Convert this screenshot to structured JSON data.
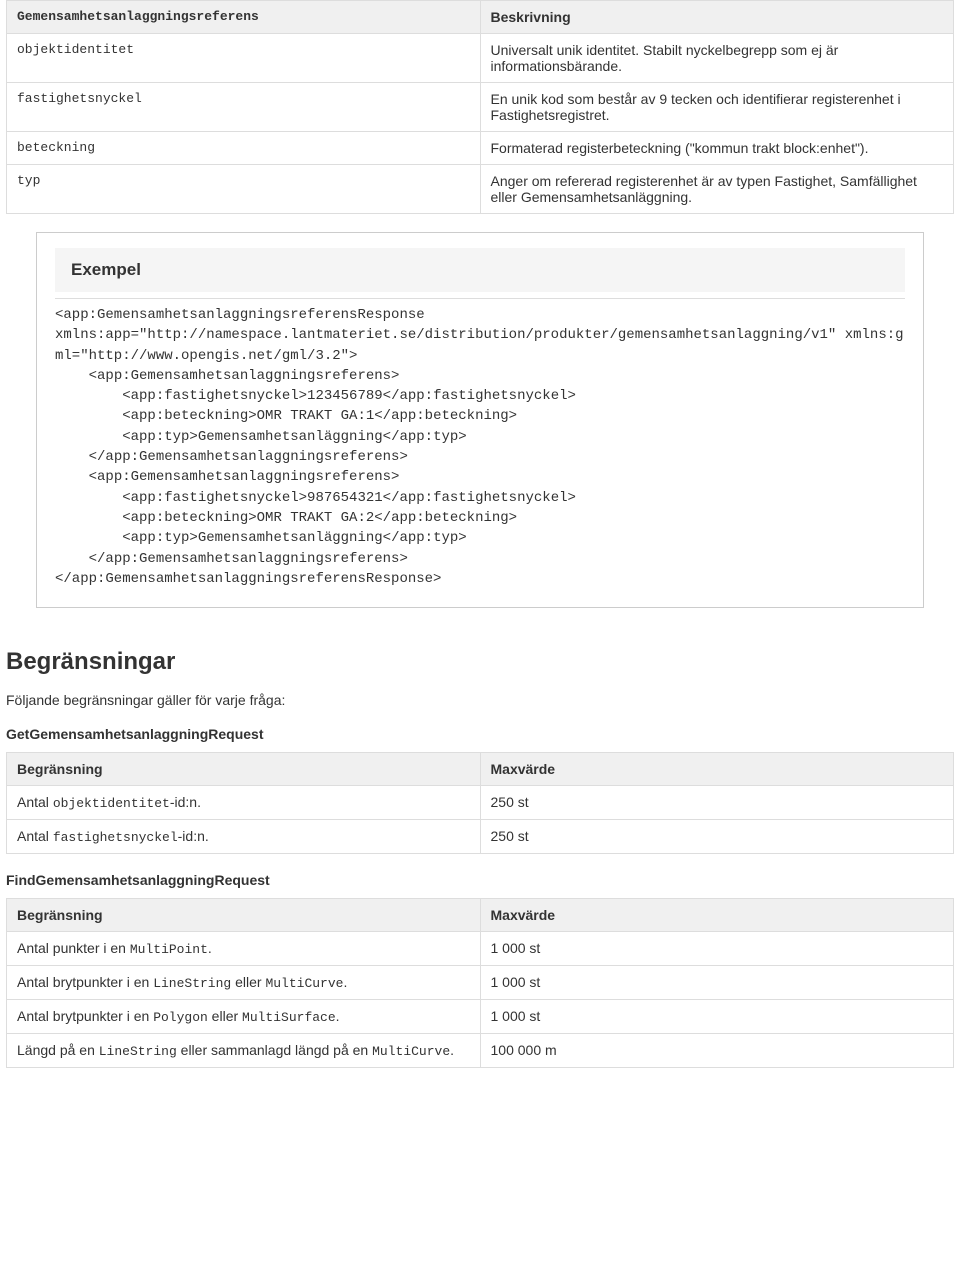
{
  "table1": {
    "headers": [
      "Gemensamhetsanlaggningsreferens",
      "Beskrivning"
    ],
    "rows": [
      {
        "name": "objektidentitet",
        "desc": "Universalt unik identitet. Stabilt nyckelbegrepp som ej är informationsbärande."
      },
      {
        "name": "fastighetsnyckel",
        "desc": "En unik kod som består av 9 tecken och identifierar registerenhet i Fastighetsregistret."
      },
      {
        "name": "beteckning",
        "desc": "Formaterad registerbeteckning (\"kommun trakt block:enhet\")."
      },
      {
        "name": "typ",
        "desc": "Anger om refererad registerenhet är av typen Fastighet, Samfällighet eller Gemensamhetsanläggning."
      }
    ]
  },
  "example": {
    "title": "Exempel",
    "code": "<app:GemensamhetsanlaggningsreferensResponse\nxmlns:app=\"http://namespace.lantmateriet.se/distribution/produkter/gemensamhetsanlaggning/v1\" xmlns:gml=\"http://www.opengis.net/gml/3.2\">\n    <app:Gemensamhetsanlaggningsreferens>\n        <app:fastighetsnyckel>123456789</app:fastighetsnyckel>\n        <app:beteckning>OMR TRAKT GA:1</app:beteckning>\n        <app:typ>Gemensamhetsanläggning</app:typ>\n    </app:Gemensamhetsanlaggningsreferens>\n    <app:Gemensamhetsanlaggningsreferens>\n        <app:fastighetsnyckel>987654321</app:fastighetsnyckel>\n        <app:beteckning>OMR TRAKT GA:2</app:beteckning>\n        <app:typ>Gemensamhetsanläggning</app:typ>\n    </app:Gemensamhetsanlaggningsreferens>\n</app:GemensamhetsanlaggningsreferensResponse>"
  },
  "limitations": {
    "heading": "Begränsningar",
    "intro": "Följande begränsningar gäller för varje fråga:",
    "req1": {
      "title": "GetGemensamhetsanlaggningRequest",
      "headers": [
        "Begränsning",
        "Maxvärde"
      ],
      "rows": [
        {
          "pre": "Antal ",
          "code": "objektidentitet",
          "post": "-id:n.",
          "max": "250 st"
        },
        {
          "pre": "Antal ",
          "code": "fastighetsnyckel",
          "post": "-id:n.",
          "max": "250 st"
        }
      ]
    },
    "req2": {
      "title": "FindGemensamhetsanlaggningRequest",
      "headers": [
        "Begränsning",
        "Maxvärde"
      ],
      "rows": [
        {
          "pre": "Antal punkter i en ",
          "code": "MultiPoint",
          "post": ".",
          "max": "1 000 st"
        },
        {
          "pre": "Antal brytpunkter i en ",
          "code": "LineString",
          "mid": " eller ",
          "code2": "MultiCurve",
          "post": ".",
          "max": "1 000 st"
        },
        {
          "pre": "Antal brytpunkter i en ",
          "code": "Polygon",
          "mid": " eller ",
          "code2": "MultiSurface",
          "post": ".",
          "max": "1 000 st"
        },
        {
          "pre": "Längd på en ",
          "code": "LineString",
          "mid": " eller sammanlagd längd på en ",
          "code2": "MultiCurve",
          "post": ".",
          "max": "100 000 m"
        }
      ]
    }
  }
}
